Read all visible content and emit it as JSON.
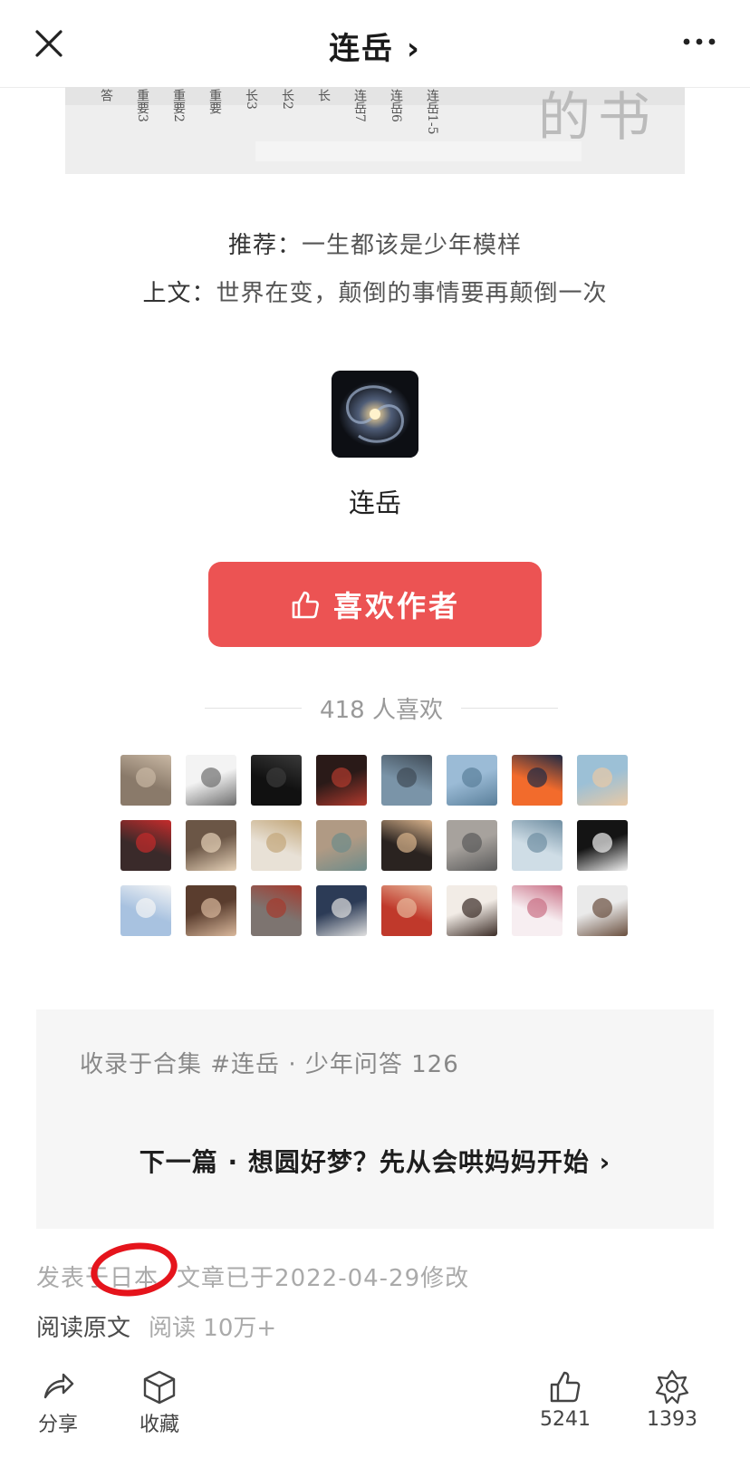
{
  "header": {
    "title": "连岳 ›",
    "close_icon": "close-icon",
    "more_icon": "more-icon"
  },
  "article_image": {
    "columns": [
      "连岳1-5",
      "连岳6",
      "连岳7",
      "长",
      "长2",
      "长3",
      "重要",
      "重要2",
      "重要3",
      "答"
    ],
    "big_text": "的书"
  },
  "recommend": {
    "label": "推荐：",
    "value": "一生都该是少年模样"
  },
  "previous": {
    "label": "上文：",
    "value": "世界在变，颠倒的事情要再颠倒一次"
  },
  "author": {
    "name": "连岳",
    "like_button": "喜欢作者",
    "likes_text": "418 人喜欢"
  },
  "collection": {
    "label": "收录于合集 #连岳 · 少年问答 126",
    "next_label": "下一篇 · 想圆好梦？先从会哄妈妈开始 ›"
  },
  "meta": {
    "published_prefix": "发表于",
    "location": "日本",
    "modified": "文章已于2022-04-29修改"
  },
  "read": {
    "original": "阅读原文",
    "reads": "阅读 10万+"
  },
  "bottom_bar": {
    "share": "分享",
    "collect": "收藏",
    "like_count": "5241",
    "wow_count": "1393"
  },
  "colors": {
    "like_button": "#ec5353",
    "annotation_circle": "#e5141c"
  }
}
